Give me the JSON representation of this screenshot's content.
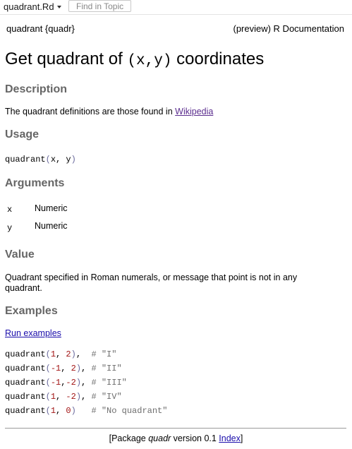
{
  "toolbar": {
    "file_label": "quadrant.Rd",
    "find_placeholder": "Find in Topic"
  },
  "header": {
    "left": "quadrant {quadr}",
    "right": "(preview) R Documentation"
  },
  "title": {
    "prefix": "Get quadrant of ",
    "code": "(x,y)",
    "suffix": " coordinates"
  },
  "description": {
    "heading": "Description",
    "text": "The quadrant definitions are those found in ",
    "link": "Wikipedia"
  },
  "usage": {
    "heading": "Usage",
    "fn": "quadrant",
    "open": "(",
    "args": "x, y",
    "close": ")"
  },
  "arguments": {
    "heading": "Arguments",
    "items": [
      {
        "name": "x",
        "desc": "Numeric"
      },
      {
        "name": "y",
        "desc": "Numeric"
      }
    ]
  },
  "value": {
    "heading": "Value",
    "text": "Quadrant specified in Roman numerals, or message that point is not in any quadrant."
  },
  "examples": {
    "heading": "Examples",
    "run_link": "Run examples",
    "lines": [
      {
        "fn": "quadrant",
        "open": "(",
        "a": "1",
        "sep1": ", ",
        "b": "2",
        "close": ")",
        "pad": ",  ",
        "comment": "# \"I\""
      },
      {
        "fn": "quadrant",
        "open": "(",
        "a": "-1",
        "sep1": ", ",
        "b": "2",
        "close": ")",
        "pad": ", ",
        "comment": "# \"II\""
      },
      {
        "fn": "quadrant",
        "open": "(",
        "a": "-1",
        "sep1": ",",
        "b": "-2",
        "close": ")",
        "pad": ", ",
        "comment": "# \"III\""
      },
      {
        "fn": "quadrant",
        "open": "(",
        "a": "1",
        "sep1": ", ",
        "b": "-2",
        "close": ")",
        "pad": ", ",
        "comment": "# \"IV\""
      },
      {
        "fn": "quadrant",
        "open": "(",
        "a": "1",
        "sep1": ", ",
        "b": "0",
        "close": ")",
        "pad": "   ",
        "comment": "# \"No quadrant\""
      }
    ]
  },
  "footer": {
    "pre": "[Package ",
    "pkg": "quadr",
    "ver": " version 0.1 ",
    "index": "Index",
    "post": "]"
  }
}
